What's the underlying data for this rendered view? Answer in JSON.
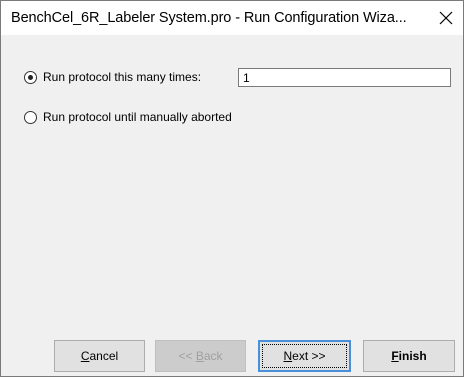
{
  "window": {
    "title": "BenchCel_6R_Labeler System.pro - Run Configuration Wiza...",
    "close_glyph": "close-icon"
  },
  "options": {
    "run_times_label": "Run protocol this many times:",
    "run_times_value": "1",
    "run_until_aborted_label": "Run protocol until manually aborted",
    "selected": "run_times"
  },
  "buttons": {
    "cancel": {
      "mnemonic": "C",
      "rest": "ancel"
    },
    "back": {
      "prefix": "<< ",
      "mnemonic": "B",
      "rest": "ack"
    },
    "next": {
      "mnemonic": "N",
      "rest": "ext >>"
    },
    "finish": {
      "mnemonic": "F",
      "rest": "inish"
    }
  },
  "colors": {
    "dialog_bg": "#f0f0f0",
    "button_bg": "#e1e1e1",
    "default_button_border": "#4a90d9",
    "disabled_text": "#a0a0a0"
  }
}
